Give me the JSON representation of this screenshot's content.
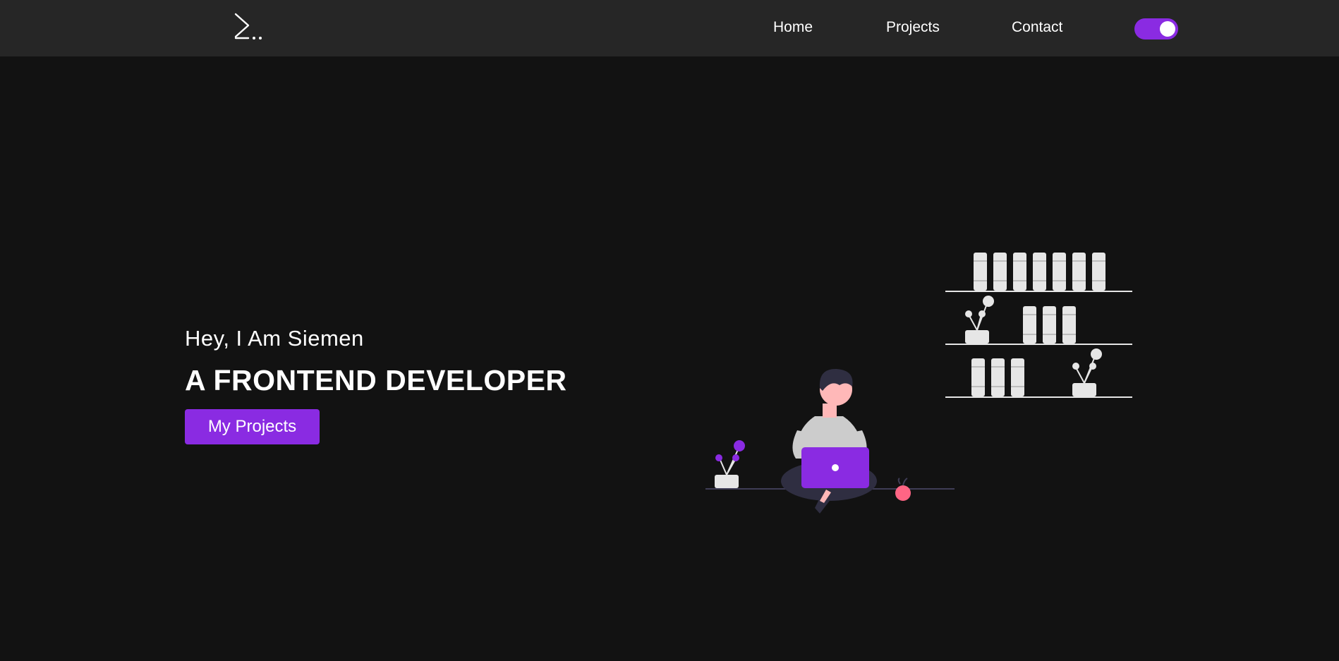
{
  "navbar": {
    "logo_text": "S..",
    "links": [
      {
        "label": "Home"
      },
      {
        "label": "Projects"
      },
      {
        "label": "Contact"
      }
    ],
    "theme_toggle": {
      "state": "on"
    }
  },
  "hero": {
    "greeting": "Hey, I Am Siemen",
    "title": "A FRONTEND DEVELOPER",
    "button_label": "My Projects"
  },
  "colors": {
    "accent": "#8a2be2",
    "background": "#121212",
    "navbar": "#262626",
    "text": "#ffffff"
  },
  "illustration": {
    "name": "developer-sitting-with-laptop"
  }
}
